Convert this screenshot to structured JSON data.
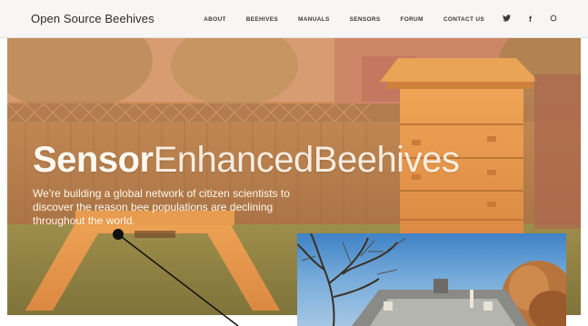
{
  "header": {
    "brand": "Open Source Beehives",
    "nav": [
      {
        "label": "ABOUT",
        "name": "nav-about"
      },
      {
        "label": "BEEHIVES",
        "name": "nav-beehives"
      },
      {
        "label": "MANUALS",
        "name": "nav-manuals"
      },
      {
        "label": "SENSORS",
        "name": "nav-sensors"
      },
      {
        "label": "FORUM",
        "name": "nav-forum"
      },
      {
        "label": "CONTACT US",
        "name": "nav-contact-us"
      }
    ],
    "social": {
      "twitter": "✦",
      "facebook": "f",
      "github": "○"
    }
  },
  "hero": {
    "title_bold": "Sensor",
    "title_light": "EnhancedBeehives",
    "subtitle": "We're building a global network of citizen scientists to discover the reason bee populations are declining throughout the world."
  },
  "colors": {
    "hero_tint": "#c7854e",
    "hive_wood": "#e69a45",
    "sky_blue": "#3f82c6"
  }
}
